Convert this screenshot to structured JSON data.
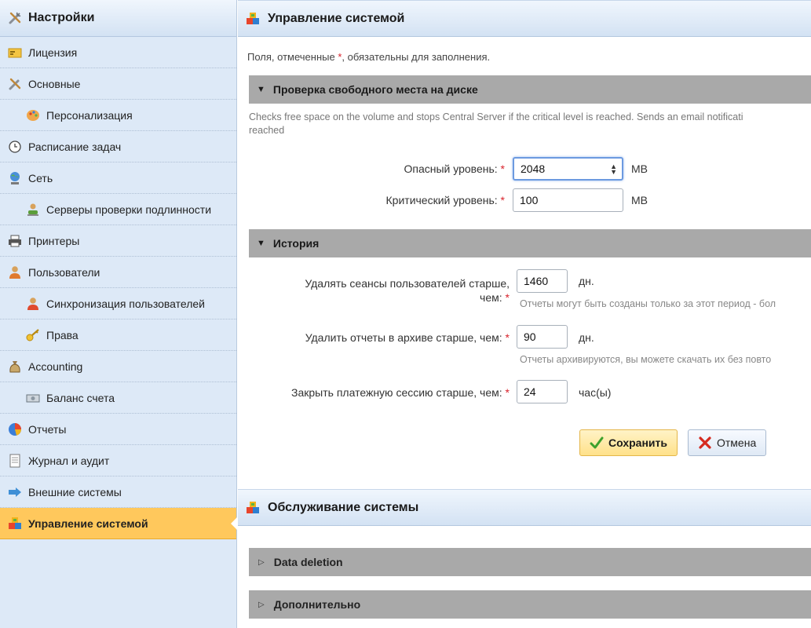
{
  "sidebar": {
    "title": "Настройки",
    "items": [
      {
        "label": "Лицензия",
        "icon": "license-icon",
        "sub": false
      },
      {
        "label": "Основные",
        "icon": "tools-icon",
        "sub": false
      },
      {
        "label": "Персонализация",
        "icon": "palette-icon",
        "sub": true
      },
      {
        "label": "Расписание задач",
        "icon": "clock-icon",
        "sub": false
      },
      {
        "label": "Сеть",
        "icon": "network-icon",
        "sub": false
      },
      {
        "label": "Серверы проверки подлинности",
        "icon": "auth-server-icon",
        "sub": true
      },
      {
        "label": "Принтеры",
        "icon": "printer-icon",
        "sub": false
      },
      {
        "label": "Пользователи",
        "icon": "user-icon",
        "sub": false
      },
      {
        "label": "Синхронизация пользователей",
        "icon": "user-sync-icon",
        "sub": true
      },
      {
        "label": "Права",
        "icon": "key-icon",
        "sub": true
      },
      {
        "label": "Accounting",
        "icon": "money-bag-icon",
        "sub": false
      },
      {
        "label": "Баланс счета",
        "icon": "banknote-icon",
        "sub": true
      },
      {
        "label": "Отчеты",
        "icon": "pie-chart-icon",
        "sub": false
      },
      {
        "label": "Журнал и аудит",
        "icon": "log-icon",
        "sub": false
      },
      {
        "label": "Внешние системы",
        "icon": "external-systems-icon",
        "sub": false
      },
      {
        "label": "Управление системой",
        "icon": "system-management-icon",
        "sub": false,
        "active": true
      }
    ]
  },
  "main": {
    "title": "Управление системой",
    "required_note_prefix": "Поля, отмеченные ",
    "required_star": "*",
    "required_note_suffix": ", обязательны для заполнения.",
    "disk_section": {
      "title": "Проверка свободного места на диске",
      "description_line1": "Checks free space on the volume and stops Central Server if the critical level is reached. Sends an email notificati",
      "description_line2": "reached",
      "danger_label": "Опасный уровень:",
      "danger_value": "2048",
      "danger_unit": "MB",
      "critical_label": "Критический уровень:",
      "critical_value": "100",
      "critical_unit": "MB"
    },
    "history_section": {
      "title": "История",
      "sessions_label_line1": "Удалять сеансы пользователей старше,",
      "sessions_label_line2": "чем:",
      "sessions_value": "1460",
      "sessions_unit": "дн.",
      "sessions_hint": "Отчеты могут быть созданы только за этот период - бол",
      "reports_label": "Удалить отчеты в архиве старше, чем:",
      "reports_value": "90",
      "reports_unit": "дн.",
      "reports_hint": "Отчеты архивируются, вы можете скачать их без повто",
      "payment_label": "Закрыть платежную сессию старше, чем:",
      "payment_value": "24",
      "payment_unit": "час(ы)"
    },
    "save_label": "Сохранить",
    "cancel_label": "Отмена"
  },
  "maintenance": {
    "title": "Обслуживание системы",
    "data_deletion": "Data deletion",
    "advanced": "Дополнительно"
  },
  "colors": {
    "sidebar_bg": "#dde9f7",
    "active_item": "#ffc85c",
    "section_bar": "#a9a9a9",
    "required": "#d9232c"
  }
}
